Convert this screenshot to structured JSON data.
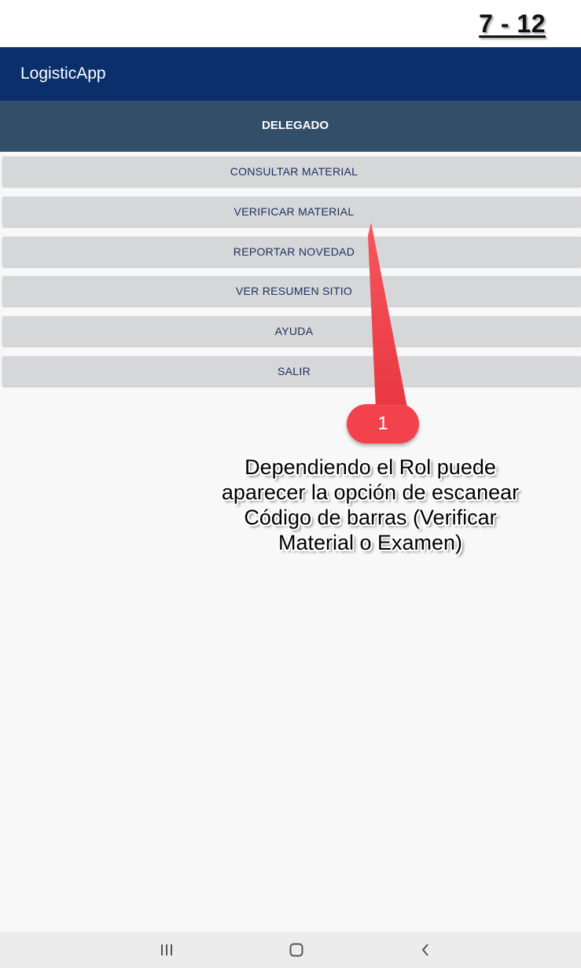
{
  "page_counter": "7 - 12",
  "app_bar": {
    "title": "LogisticApp"
  },
  "role": {
    "label": "DELEGADO"
  },
  "menu": [
    {
      "label": "CONSULTAR MATERIAL"
    },
    {
      "label": "VERIFICAR MATERIAL"
    },
    {
      "label": "REPORTAR NOVEDAD"
    },
    {
      "label": "VER RESUMEN SITIO"
    },
    {
      "label": "AYUDA"
    },
    {
      "label": "SALIR"
    }
  ],
  "annotation": {
    "number": "1",
    "lines": [
      "Dependiendo el Rol puede",
      "aparecer la opción de escanear",
      "Código de barras (Verificar",
      "Material o Examen)"
    ]
  },
  "nav": {
    "recents_icon": "recent-apps-icon",
    "home_icon": "home-icon",
    "back_icon": "back-icon"
  },
  "colors": {
    "app_bar": "#0a2f6b",
    "role_bar": "#334e68",
    "button_bg": "#d6d7d8",
    "button_text": "#1c2f5e",
    "badge": "#f2434c"
  }
}
